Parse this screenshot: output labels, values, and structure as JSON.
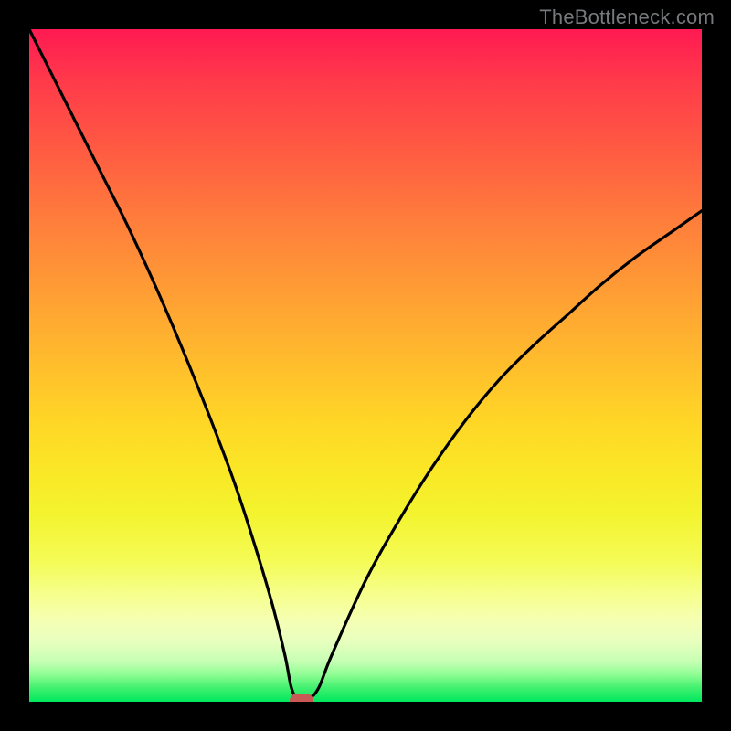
{
  "watermark": "TheBottleneck.com",
  "colors": {
    "frame": "#000000",
    "curve": "#000000",
    "marker": "#c75a54",
    "gradient_top": "#ff1a52",
    "gradient_bottom": "#00e85e"
  },
  "chart_data": {
    "type": "line",
    "title": "",
    "xlabel": "",
    "ylabel": "",
    "xlim": [
      0,
      100
    ],
    "ylim": [
      0,
      100
    ],
    "x": [
      0,
      5,
      10,
      15,
      20,
      25,
      30,
      33,
      36,
      38,
      39,
      40,
      41.5,
      43,
      45,
      50,
      55,
      60,
      65,
      70,
      75,
      80,
      85,
      90,
      95,
      100
    ],
    "y": [
      100,
      90,
      80,
      70,
      59,
      47,
      34,
      25,
      15,
      7,
      2,
      0.5,
      0.5,
      2,
      7,
      18,
      27,
      35,
      42,
      48,
      53,
      57.5,
      62,
      66,
      69.5,
      73
    ],
    "minimum_x": 40,
    "annotations": [
      {
        "type": "marker",
        "x": 40.5,
        "y": 0.2
      }
    ]
  }
}
